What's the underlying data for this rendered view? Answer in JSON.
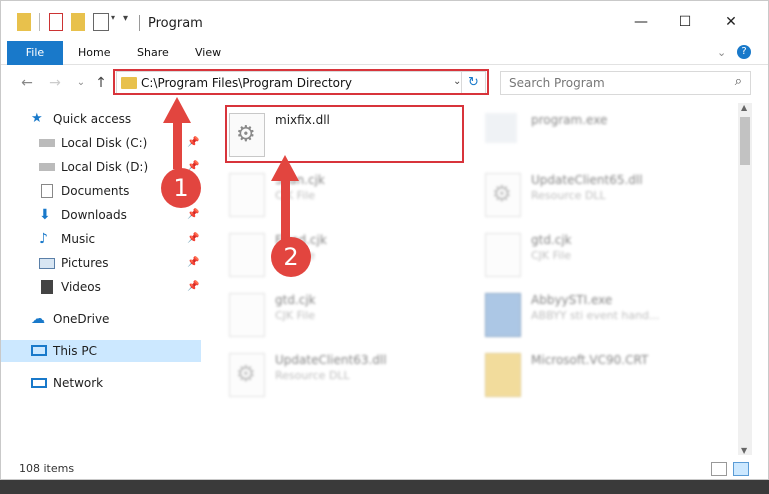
{
  "window": {
    "title": "Program"
  },
  "ribbon": {
    "tabs": [
      "File",
      "Home",
      "Share",
      "View"
    ]
  },
  "address": {
    "path": "C:\\Program Files\\Program Directory"
  },
  "search": {
    "placeholder": "Search Program"
  },
  "sidebar": {
    "items": [
      {
        "label": "Quick access"
      },
      {
        "label": "Local Disk (C:)"
      },
      {
        "label": "Local Disk (D:)"
      },
      {
        "label": "Documents"
      },
      {
        "label": "Downloads"
      },
      {
        "label": "Music"
      },
      {
        "label": "Pictures"
      },
      {
        "label": "Videos"
      },
      {
        "label": "OneDrive"
      },
      {
        "label": "This PC"
      },
      {
        "label": "Network"
      }
    ]
  },
  "files": [
    {
      "name": "mixfix.dll",
      "type": ""
    },
    {
      "name": "program.exe",
      "type": ""
    },
    {
      "name": "Scan.cjk",
      "type": "CJK File"
    },
    {
      "name": "UpdateClient65.dll",
      "type": "Resource DLL"
    },
    {
      "name": "Fixed.cjk",
      "type": "CJK File"
    },
    {
      "name": "gtd.cjk",
      "type": "CJK File"
    },
    {
      "name": "gtd.cjk",
      "type": "CJK File"
    },
    {
      "name": "AbbyySTI.exe",
      "type": "ABBYY sti event hand..."
    },
    {
      "name": "UpdateClient63.dll",
      "type": "Resource DLL"
    },
    {
      "name": "Microsoft.VC90.CRT",
      "type": ""
    }
  ],
  "annotations": {
    "step1": "1",
    "step2": "2"
  },
  "status": {
    "items": "108 items"
  },
  "colors": {
    "accent": "#1979ca",
    "highlight": "#d8343b",
    "arrow": "#e2453f"
  }
}
